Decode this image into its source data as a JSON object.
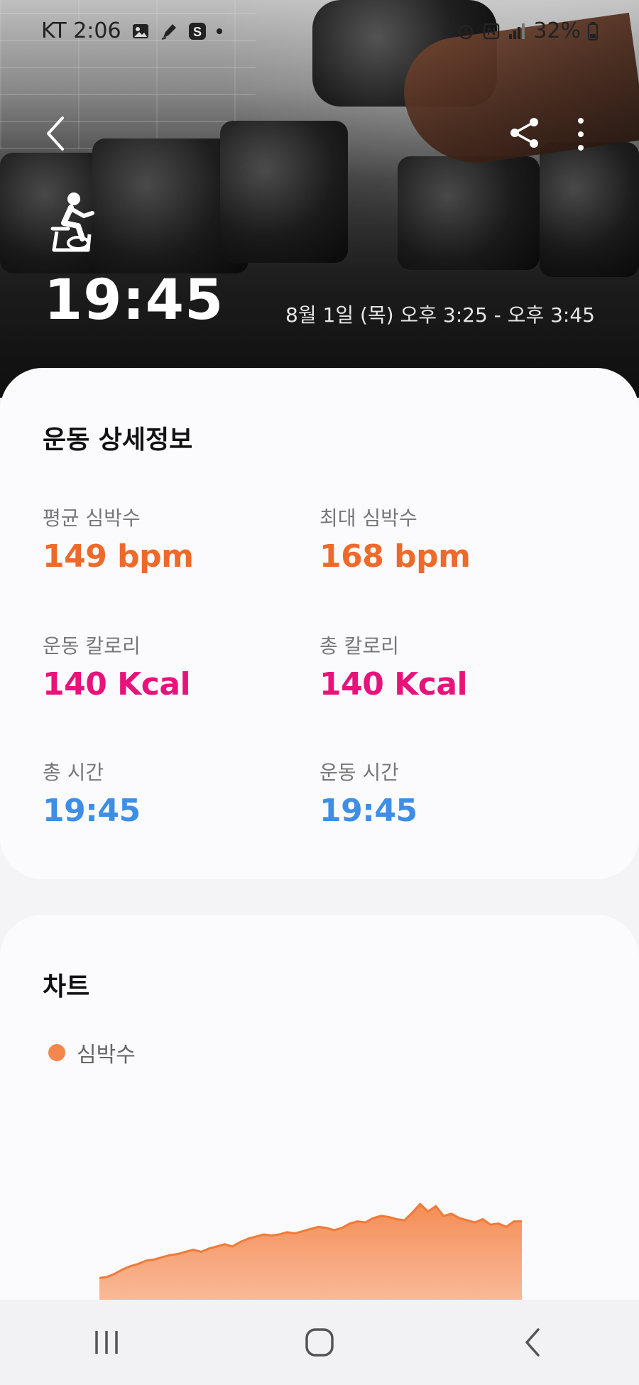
{
  "status_bar": {
    "carrier_time": "KT 2:06",
    "battery": "32%",
    "icons": [
      "gallery-icon",
      "pen-icon",
      "s-app-icon",
      "notification-dot-icon",
      "alarm-icon",
      "nfc-icon",
      "signal-icon",
      "battery-icon"
    ]
  },
  "header": {
    "back_icon": "chevron-left-icon",
    "share_icon": "share-icon",
    "more_icon": "more-vertical-icon",
    "exercise_icon": "exercise-bike-icon",
    "duration": "19:45",
    "date_range": "8월 1일 (목) 오후 3:25 - 오후 3:45"
  },
  "details": {
    "title": "운동 상세정보",
    "metrics": [
      {
        "label": "평균 심박수",
        "value": "149 bpm",
        "color": "#ee6a2a"
      },
      {
        "label": "최대 심박수",
        "value": "168 bpm",
        "color": "#ee6a2a"
      },
      {
        "label": "운동 칼로리",
        "value": "140 Kcal",
        "color": "#e8137a"
      },
      {
        "label": "총 칼로리",
        "value": "140 Kcal",
        "color": "#e8137a"
      },
      {
        "label": "총 시간",
        "value": "19:45",
        "color": "#3e8ee6"
      },
      {
        "label": "운동 시간",
        "value": "19:45",
        "color": "#3e8ee6"
      }
    ]
  },
  "chart": {
    "title": "차트",
    "legend_label": "심박수",
    "legend_color": "#f4874b"
  },
  "chart_data": {
    "type": "area",
    "series": [
      {
        "name": "심박수",
        "values": [
          100,
          101,
          104,
          108,
          111,
          113,
          116,
          117,
          119,
          121,
          122,
          124,
          126,
          124,
          127,
          129,
          131,
          129,
          133,
          136,
          138,
          140,
          139,
          140,
          142,
          141,
          143,
          145,
          147,
          146,
          144,
          146,
          150,
          152,
          151,
          155,
          157,
          156,
          154,
          153,
          160,
          168,
          161,
          166,
          157,
          159,
          155,
          153,
          151,
          154,
          149,
          150,
          147,
          152,
          152
        ]
      }
    ],
    "color": "#f4874b"
  },
  "nav": {
    "recents_icon": "recent-apps-icon",
    "home_icon": "home-icon",
    "back_icon": "back-icon"
  }
}
